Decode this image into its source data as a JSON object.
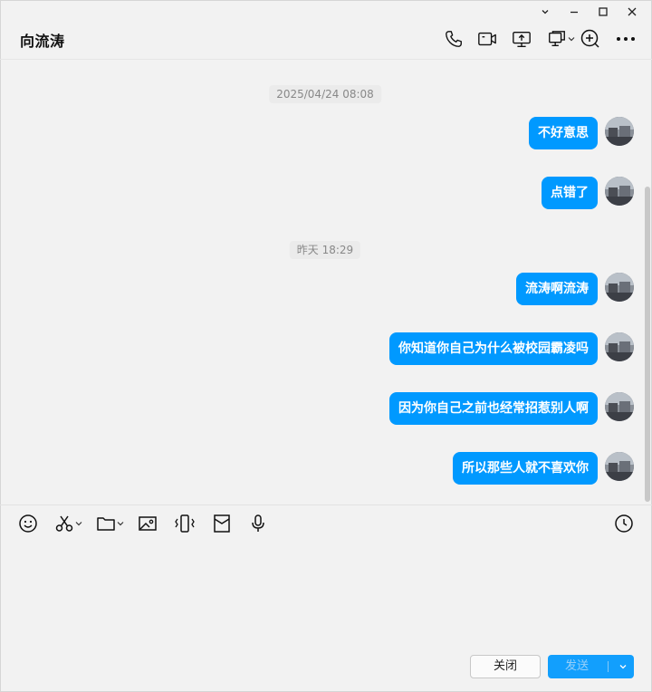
{
  "window": {
    "controls": [
      "chevron-down-icon",
      "minimize-icon",
      "maximize-icon",
      "close-icon"
    ]
  },
  "header": {
    "title": "向流涛",
    "icons": [
      "phone-icon",
      "video-call-icon",
      "screen-share-icon",
      "remote-desktop-icon",
      "add-member-icon",
      "more-icon"
    ]
  },
  "messages": {
    "timestamps": [
      "2025/04/24 08:08",
      "昨天 18:29"
    ],
    "items": [
      {
        "text": "不好意思",
        "sender": "self"
      },
      {
        "text": "点错了",
        "sender": "self"
      },
      {
        "text": "流涛啊流涛",
        "sender": "self"
      },
      {
        "text": "你知道你自己为什么被校园霸凌吗",
        "sender": "self"
      },
      {
        "text": "因为你自己之前也经常招惹别人啊",
        "sender": "self"
      },
      {
        "text": "所以那些人就不喜欢你",
        "sender": "self"
      }
    ]
  },
  "toolbar": {
    "tools": [
      "emoji-icon",
      "screenshot-scissors-icon",
      "folder-icon",
      "image-icon",
      "shake-icon",
      "red-packet-icon",
      "microphone-icon"
    ],
    "history_icon": "clock-icon"
  },
  "input": {
    "value": "",
    "placeholder": ""
  },
  "footer": {
    "close_label": "关闭",
    "send_label": "发送"
  },
  "colors": {
    "accent": "#0099ff",
    "background": "#f2f2f2",
    "bubble_text": "#ffffff"
  }
}
